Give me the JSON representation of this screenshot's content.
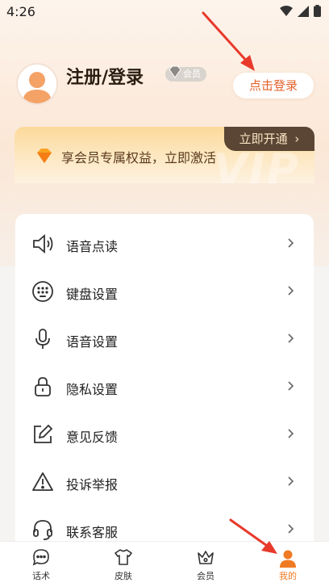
{
  "status_bar": {
    "time": "4:26"
  },
  "profile": {
    "name": "注册/登录",
    "member_badge": "会员",
    "login_button": "点击登录"
  },
  "vip": {
    "tab_label": "立即开通",
    "tab_chevron": "›",
    "promo_text": "享会员专属权益，立即激活",
    "watermark": "VIP"
  },
  "menu": {
    "items": [
      {
        "label": "语音点读",
        "icon": "speaker-icon"
      },
      {
        "label": "键盘设置",
        "icon": "keyboard-icon"
      },
      {
        "label": "语音设置",
        "icon": "microphone-icon"
      },
      {
        "label": "隐私设置",
        "icon": "lock-icon"
      },
      {
        "label": "意见反馈",
        "icon": "edit-icon"
      },
      {
        "label": "投诉举报",
        "icon": "warning-icon"
      },
      {
        "label": "联系客服",
        "icon": "headset-icon"
      }
    ]
  },
  "tabbar": {
    "tabs": [
      {
        "label": "话术",
        "icon": "chat-icon"
      },
      {
        "label": "皮肤",
        "icon": "shirt-icon"
      },
      {
        "label": "会员",
        "icon": "crown-icon"
      },
      {
        "label": "我的",
        "icon": "user-icon",
        "active": true
      }
    ]
  },
  "colors": {
    "accent": "#f07a23",
    "login_text": "#e5602a",
    "vip_tab": "#5b4534",
    "annotation_arrow": "#e8392b"
  }
}
